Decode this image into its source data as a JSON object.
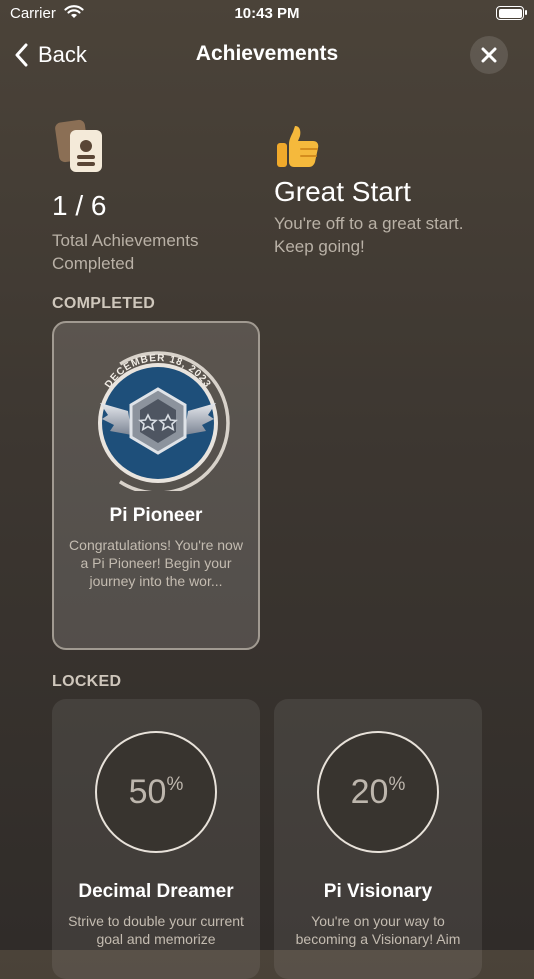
{
  "status_bar": {
    "carrier": "Carrier",
    "time": "10:43 PM"
  },
  "nav": {
    "back_label": "Back",
    "title": "Achievements"
  },
  "summary": {
    "count": "1 / 6",
    "count_label": "Total Achievements Completed",
    "level_title": "Great Start",
    "level_text": "You're off to a great start. Keep going!"
  },
  "sections": {
    "completed": "COMPLETED",
    "locked": "LOCKED"
  },
  "completed": [
    {
      "date": "DECEMBER 18, 2023",
      "title": "Pi Pioneer",
      "description": "Congratulations! You're now a Pi Pioneer! Begin your journey into the wor..."
    }
  ],
  "locked": [
    {
      "progress": "50",
      "unit": "%",
      "title": "Decimal Dreamer",
      "description": "Strive to double your current goal and memorize"
    },
    {
      "progress": "20",
      "unit": "%",
      "title": "Pi Visionary",
      "description": "You're on your way to becoming a Visionary! Aim"
    }
  ],
  "colors": {
    "accent_text": "#b9b1a6",
    "badge_blue": "#1e4f7a",
    "badge_ring": "#d8d2ca"
  },
  "icons": {
    "back": "chevron-left-icon",
    "close": "close-icon",
    "total": "id-cards-icon",
    "level": "thumbs-up-icon",
    "badge": "two-star-wings-badge-icon"
  }
}
